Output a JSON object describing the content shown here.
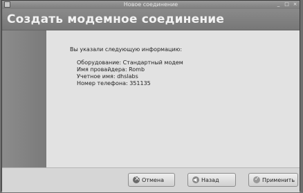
{
  "window": {
    "title": "Новое соединение"
  },
  "header": {
    "title": "Создать модемное соединение"
  },
  "summary": {
    "intro": "Вы указали следующую информацию:",
    "rows": [
      {
        "label": "Оборудование:",
        "value": "Стандартный модем"
      },
      {
        "label": "Имя провайдера:",
        "value": "Romb"
      },
      {
        "label": "Учетное имя:",
        "value": "dhslabs"
      },
      {
        "label": "Номер телефона:",
        "value": "351135"
      }
    ]
  },
  "buttons": {
    "cancel": "Отмена",
    "back": "Назад",
    "apply": "Применить"
  },
  "icons": {
    "cancel": "cancel-icon",
    "back": "back-arrow-icon",
    "apply": "apply-check-icon"
  }
}
